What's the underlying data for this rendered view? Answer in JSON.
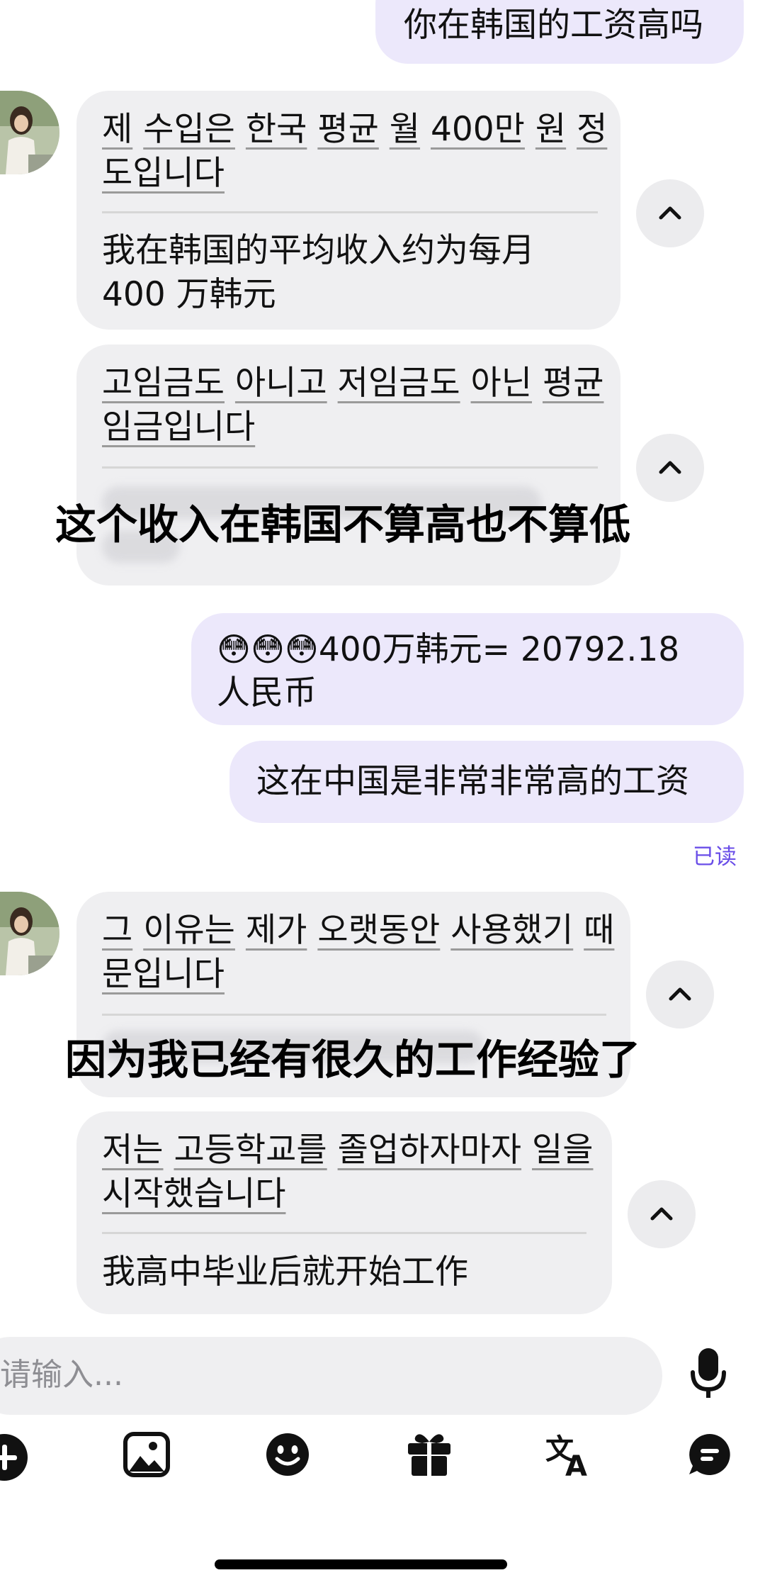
{
  "messages": {
    "m1": {
      "text": "你在韩国的工资高吗"
    },
    "m2": {
      "line1": [
        "제",
        "수입은",
        "한국",
        "평균",
        "월",
        "400만",
        "원",
        "정"
      ],
      "line2": "도입니다",
      "translation_l1": "我在韩国的平均收入约为每月",
      "translation_l2": "400 万韩元"
    },
    "m3": {
      "line1": [
        "고임금도",
        "아니고",
        "저임금도",
        "아닌",
        "평균"
      ],
      "line2": "임금입니다",
      "caption": "这个收入在韩国不算高也不算低"
    },
    "m4": {
      "emojis": "😳😳😳",
      "line1": "400万韩元= 20792.18",
      "line2": "人民币"
    },
    "m5": {
      "text": "这在中国是非常非常高的工资"
    },
    "read_status": "已读",
    "m6": {
      "line1": [
        "그",
        "이유는",
        "제가",
        "오랫동안",
        "사용했기",
        "때"
      ],
      "line2": "문입니다",
      "caption": "因为我已经有很久的工作经验了"
    },
    "m7": {
      "line1": [
        "저는",
        "고등학교를",
        "졸업하자마자",
        "일을"
      ],
      "line2": "시작했습니다",
      "translation": "我高中毕业后就开始工作"
    }
  },
  "input": {
    "placeholder": "请输入..."
  },
  "icons": {
    "mic": "microphone-icon",
    "toolbar": [
      "plus-icon",
      "image-icon",
      "emoji-icon",
      "gift-icon",
      "translate-icon",
      "chat-icon"
    ]
  },
  "colors": {
    "accent": "#6a4ee8",
    "sent_bubble": "#ece8fb",
    "recv_bubble": "#efeff1"
  }
}
